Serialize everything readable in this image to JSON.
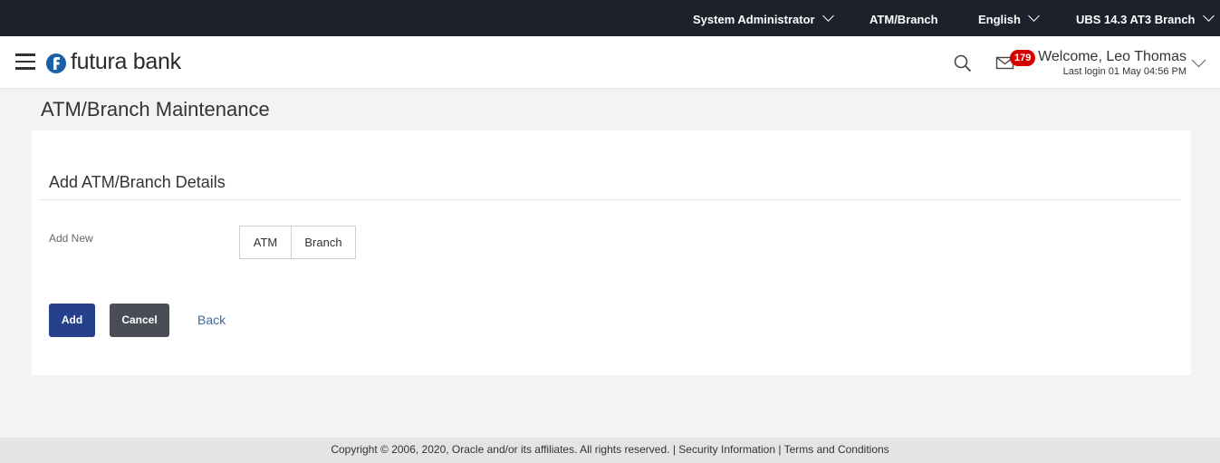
{
  "topbar": {
    "role": "System Administrator",
    "atm_branch": "ATM/Branch",
    "language": "English",
    "entity": "UBS 14.3 AT3 Branch"
  },
  "header": {
    "brand": "futura bank",
    "notification_count": "179",
    "welcome": "Welcome, Leo Thomas",
    "last_login": "Last login 01 May 04:56 PM"
  },
  "page": {
    "title": "ATM/Branch Maintenance"
  },
  "form": {
    "section_title": "Add ATM/Branch Details",
    "add_new_label": "Add New",
    "options": [
      "ATM",
      "Branch"
    ]
  },
  "actions": {
    "add": "Add",
    "cancel": "Cancel",
    "back": "Back"
  },
  "footer": {
    "copyright": "Copyright © 2006, 2020, Oracle and/or its affiliates. All rights reserved.",
    "separator": "|",
    "security": "Security Information",
    "terms": "Terms and Conditions"
  },
  "colors": {
    "topbar_bg": "#1c212b",
    "primary_button": "#27408b",
    "secondary_button": "#4a4d55",
    "badge": "#d50000",
    "link": "#3b6aa0"
  },
  "icons": [
    "hamburger-menu-icon",
    "futura-bank-logo-icon",
    "search-icon",
    "mail-icon",
    "chevron-down-icon"
  ]
}
